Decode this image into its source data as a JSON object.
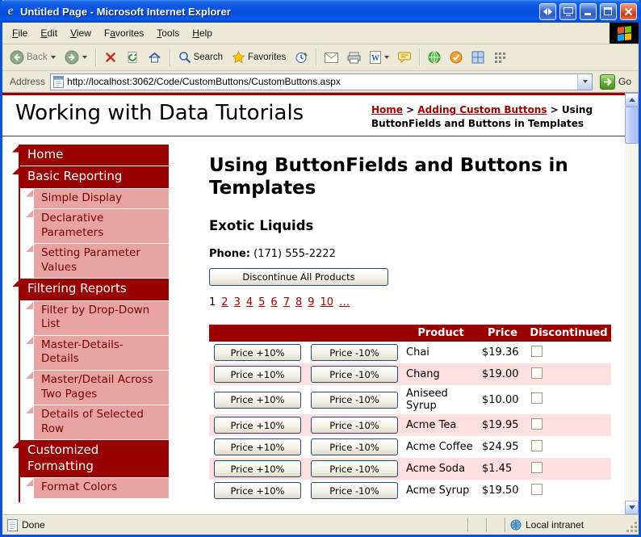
{
  "colors": {
    "maroon": "#990000",
    "sidebar_pink": "#E8A3A3",
    "row_pink": "#FFDFDF"
  },
  "window": {
    "title": "Untitled Page - Microsoft Internet Explorer"
  },
  "menu": {
    "items": [
      {
        "label": "File",
        "accel": 0
      },
      {
        "label": "Edit",
        "accel": 0
      },
      {
        "label": "View",
        "accel": 0
      },
      {
        "label": "Favorites",
        "accel": 1
      },
      {
        "label": "Tools",
        "accel": 0
      },
      {
        "label": "Help",
        "accel": 0
      }
    ]
  },
  "toolbar": {
    "back": "Back",
    "search": "Search",
    "favorites": "Favorites"
  },
  "address": {
    "label": "Address",
    "url": "http://localhost:3062/Code/CustomButtons/CustomButtons.aspx",
    "go": "Go"
  },
  "status": {
    "left": "Done",
    "zone": "Local intranet"
  },
  "page": {
    "site_title": "Working with Data Tutorials",
    "breadcrumb": [
      {
        "label": "Home",
        "link": true
      },
      {
        "label": "Adding Custom Buttons",
        "link": true
      },
      {
        "label": "Using ButtonFields and Buttons in Templates",
        "link": false
      }
    ],
    "sidebar": [
      {
        "label": "Home",
        "level": 0
      },
      {
        "label": "Basic Reporting",
        "level": 0
      },
      {
        "label": "Simple Display",
        "level": 1
      },
      {
        "label": "Declarative\nParameters",
        "level": 1
      },
      {
        "label": "Setting Parameter\nValues",
        "level": 1
      },
      {
        "label": "Filtering Reports",
        "level": 0
      },
      {
        "label": "Filter by Drop-Down\nList",
        "level": 1
      },
      {
        "label": "Master-Details-\nDetails",
        "level": 1
      },
      {
        "label": "Master/Detail Across\nTwo Pages",
        "level": 1
      },
      {
        "label": "Details of Selected\nRow",
        "level": 1
      },
      {
        "label": "Customized\nFormatting",
        "level": 0
      },
      {
        "label": "Format Colors",
        "level": 1
      }
    ],
    "main": {
      "title": "Using ButtonFields and Buttons in\nTemplates",
      "supplier": "Exotic Liquids",
      "phone_label": "Phone:",
      "phone": "(171) 555-2222",
      "discontinue_button": "Discontinue All Products",
      "pager": {
        "current": "1",
        "links": [
          "2",
          "3",
          "4",
          "5",
          "6",
          "7",
          "8",
          "9",
          "10",
          "…"
        ]
      },
      "table": {
        "headers": [
          "",
          "",
          "Product",
          "Price",
          "Discontinued"
        ],
        "price_up_label": "Price +10%",
        "price_down_label": "Price -10%",
        "rows": [
          {
            "product": "Chai",
            "price": "$19.36",
            "discontinued": false
          },
          {
            "product": "Chang",
            "price": "$19.00",
            "discontinued": false
          },
          {
            "product": "Aniseed Syrup",
            "price": "$10.00",
            "discontinued": false
          },
          {
            "product": "Acme Tea",
            "price": "$19.95",
            "discontinued": false
          },
          {
            "product": "Acme Coffee",
            "price": "$24.95",
            "discontinued": false
          },
          {
            "product": "Acme Soda",
            "price": "$1.45",
            "discontinued": false
          },
          {
            "product": "Acme Syrup",
            "price": "$19.50",
            "discontinued": false
          }
        ]
      }
    }
  },
  "icons": {
    "titlebar": [
      "ie-logo-icon",
      "nav-arrows-icon",
      "screen-icon",
      "minimize-icon",
      "maximize-icon",
      "close-icon"
    ],
    "menubar": [
      "windows-logo-icon"
    ],
    "toolbar": [
      "back-icon",
      "forward-icon",
      "stop-icon",
      "refresh-icon",
      "home-icon",
      "search-icon",
      "favorites-star-icon",
      "history-icon",
      "mail-icon",
      "print-icon",
      "edit-icon",
      "discuss-icon",
      "globe-icon",
      "check-badge-icon",
      "grid-icon",
      "dotted-grid-icon"
    ],
    "address": [
      "page-icon",
      "chevron-down-icon",
      "go-arrow-icon"
    ],
    "status": [
      "document-icon",
      "intranet-zone-icon"
    ]
  }
}
